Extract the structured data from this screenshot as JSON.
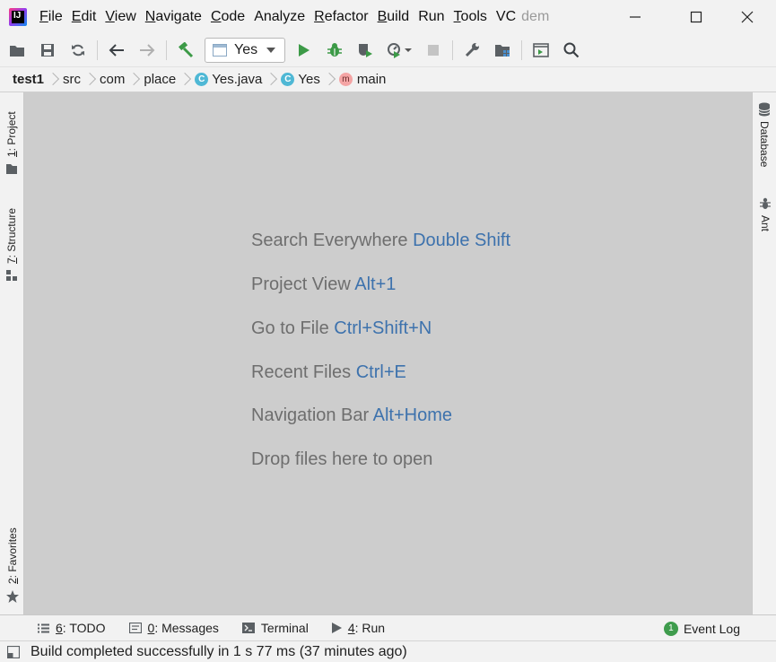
{
  "menu": {
    "items": [
      {
        "label": "File",
        "mnemonic": "F",
        "rest": "ile"
      },
      {
        "label": "Edit",
        "mnemonic": "E",
        "rest": "dit"
      },
      {
        "label": "View",
        "mnemonic": "V",
        "rest": "iew"
      },
      {
        "label": "Navigate",
        "mnemonic": "N",
        "rest": "avigate"
      },
      {
        "label": "Code",
        "mnemonic": "C",
        "rest": "ode"
      },
      {
        "label": "Analyze",
        "mnemonic": "",
        "rest": "Analyze"
      },
      {
        "label": "Refactor",
        "mnemonic": "R",
        "rest": "efactor"
      },
      {
        "label": "Build",
        "mnemonic": "B",
        "rest": "uild"
      },
      {
        "label": "Run",
        "mnemonic": "",
        "rest": "Run"
      },
      {
        "label": "Tools",
        "mnemonic": "T",
        "rest": "ools"
      },
      {
        "label": "VC",
        "mnemonic": "",
        "rest": "VC"
      }
    ],
    "project_hint": "dem"
  },
  "toolbar": {
    "run_config": "Yes"
  },
  "breadcrumb": {
    "items": [
      "test1",
      "src",
      "com",
      "place",
      "Yes.java",
      "Yes",
      "main"
    ],
    "class_icon_letter": "C",
    "method_icon_letter": "m"
  },
  "left_tabs": {
    "project": {
      "num": "1",
      "label": ": Project"
    },
    "structure": {
      "num": "7",
      "label": ": Structure"
    },
    "favorites": {
      "num": "2",
      "label": ": Favorites"
    }
  },
  "right_tabs": {
    "database": "Database",
    "ant": "Ant"
  },
  "editor": {
    "hints": [
      {
        "text": "Search Everywhere ",
        "key": "Double Shift"
      },
      {
        "text": "Project View ",
        "key": "Alt+1"
      },
      {
        "text": "Go to File ",
        "key": "Ctrl+Shift+N"
      },
      {
        "text": "Recent Files ",
        "key": "Ctrl+E"
      },
      {
        "text": "Navigation Bar ",
        "key": "Alt+Home"
      },
      {
        "text": "Drop files here to open",
        "key": ""
      }
    ]
  },
  "tool_windows": {
    "todo": {
      "num": "6",
      "label": ": TODO"
    },
    "messages": {
      "num": "0",
      "label": ": Messages"
    },
    "terminal": {
      "label": "Terminal"
    },
    "run": {
      "num": "4",
      "label": ": Run"
    }
  },
  "event_log": {
    "count": "1",
    "label": "Event Log"
  },
  "status": {
    "message": "Build completed successfully in 1 s 77 ms (37 minutes ago)"
  },
  "colors": {
    "editor_bg": "#cdcdcd",
    "hint_text": "#6e6e6e",
    "hint_key": "#3d72ad",
    "run_green": "#3c9a47",
    "chrome_bg": "#f2f2f2"
  }
}
